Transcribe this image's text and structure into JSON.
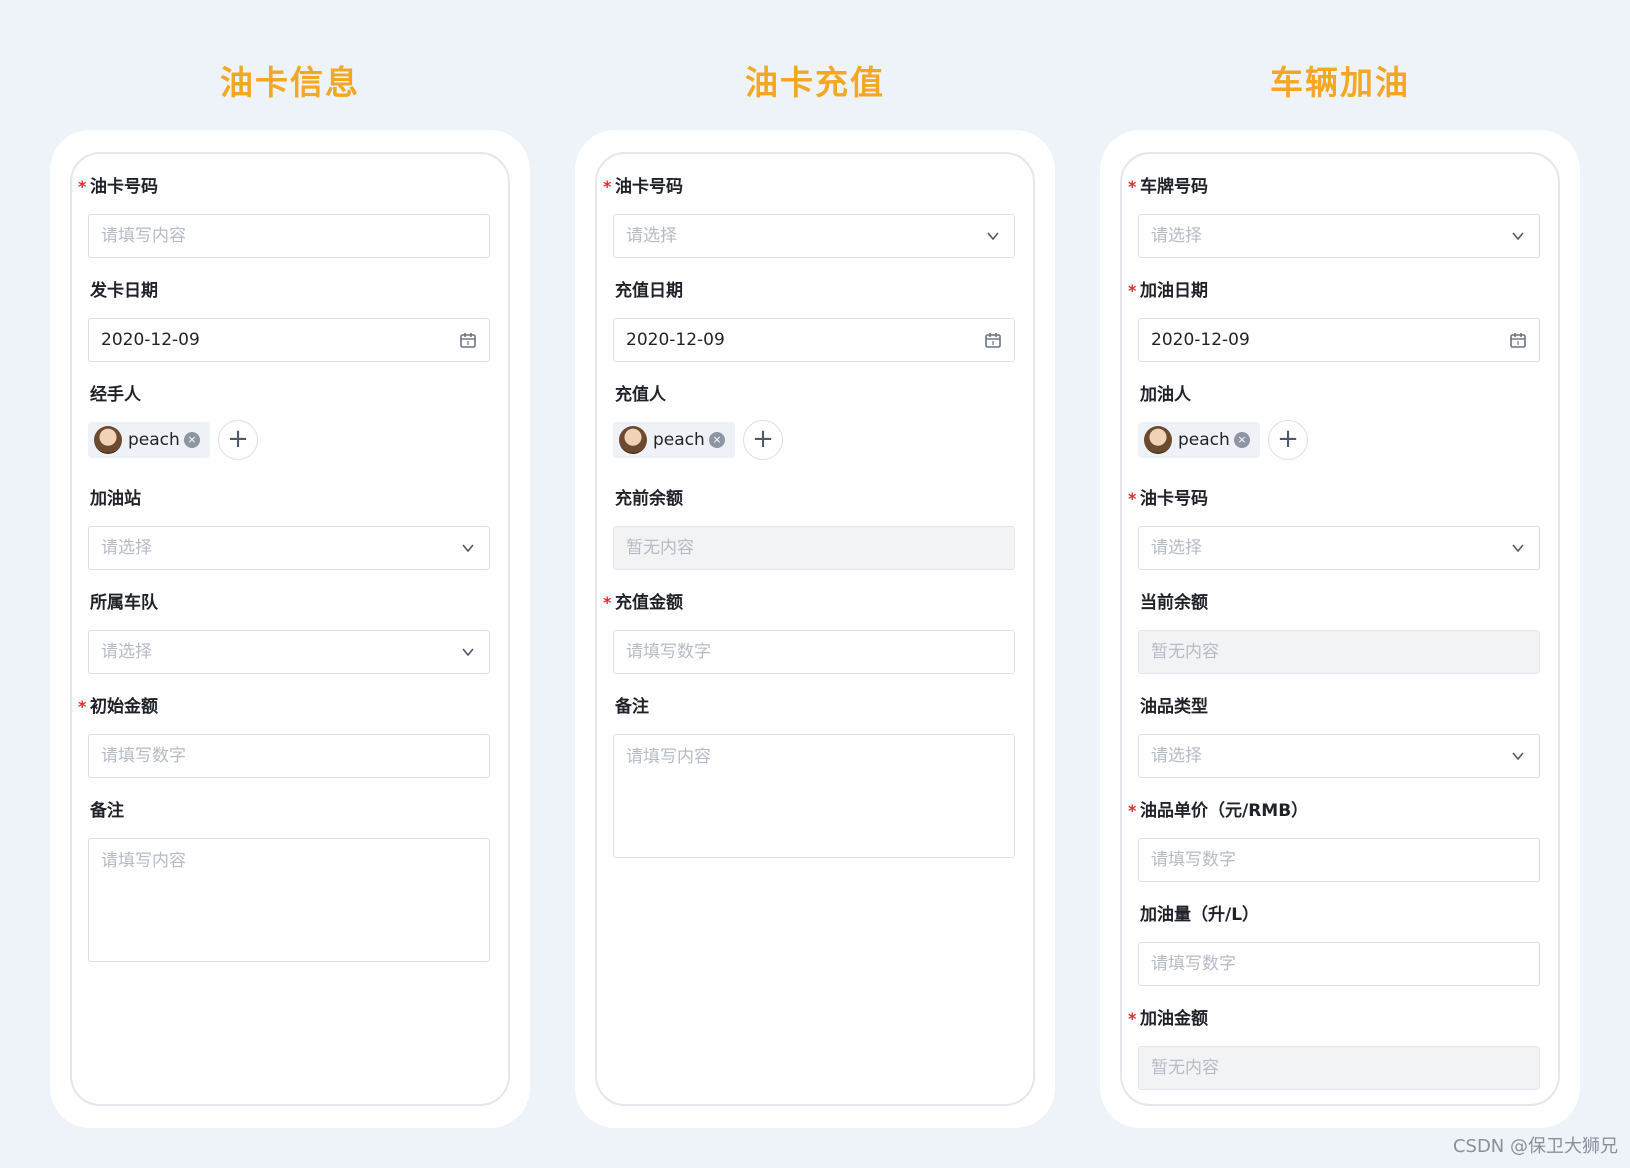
{
  "columns": [
    {
      "title": "油卡信息",
      "fields": {
        "card_no": {
          "label": "油卡号码",
          "placeholder": "请填写内容"
        },
        "issue_date": {
          "label": "发卡日期",
          "value": "2020-12-09"
        },
        "handler": {
          "label": "经手人",
          "person": "peach"
        },
        "station": {
          "label": "加油站",
          "placeholder": "请选择"
        },
        "fleet": {
          "label": "所属车队",
          "placeholder": "请选择"
        },
        "init_amount": {
          "label": "初始金额",
          "placeholder": "请填写数字"
        },
        "remark": {
          "label": "备注",
          "placeholder": "请填写内容"
        }
      }
    },
    {
      "title": "油卡充值",
      "fields": {
        "card_no": {
          "label": "油卡号码",
          "placeholder": "请选择"
        },
        "recharge_date": {
          "label": "充值日期",
          "value": "2020-12-09"
        },
        "recharger": {
          "label": "充值人",
          "person": "peach"
        },
        "balance_before": {
          "label": "充前余额",
          "placeholder": "暂无内容"
        },
        "recharge_amount": {
          "label": "充值金额",
          "placeholder": "请填写数字"
        },
        "remark": {
          "label": "备注",
          "placeholder": "请填写内容"
        }
      }
    },
    {
      "title": "车辆加油",
      "fields": {
        "plate_no": {
          "label": "车牌号码",
          "placeholder": "请选择"
        },
        "refuel_date": {
          "label": "加油日期",
          "value": "2020-12-09"
        },
        "refueler": {
          "label": "加油人",
          "person": "peach"
        },
        "card_no": {
          "label": "油卡号码",
          "placeholder": "请选择"
        },
        "balance": {
          "label": "当前余额",
          "placeholder": "暂无内容"
        },
        "oil_type": {
          "label": "油品类型",
          "placeholder": "请选择"
        },
        "unit_price": {
          "label": "油品单价（元/RMB）",
          "placeholder": "请填写数字"
        },
        "volume": {
          "label": "加油量（升/L）",
          "placeholder": "请填写数字"
        },
        "amount": {
          "label": "加油金额",
          "placeholder": "暂无内容"
        }
      }
    }
  ],
  "required_mark": "*",
  "add_symbol": "+",
  "remove_symbol": "×",
  "watermark": "CSDN @保卫大狮兄",
  "colors": {
    "title": "#f5a623",
    "required": "#f5222d",
    "background": "#eef3fa"
  },
  "icons": [
    "chevron-down-icon",
    "calendar-icon",
    "close-circle-icon",
    "plus-icon",
    "avatar"
  ]
}
